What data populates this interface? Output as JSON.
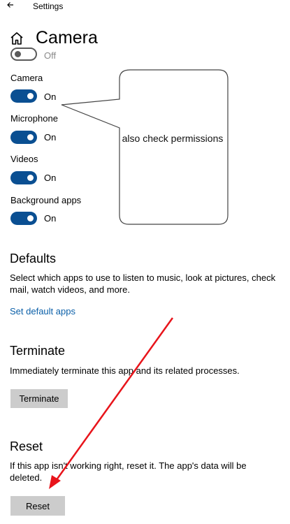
{
  "titlebar": {
    "title": "Settings"
  },
  "header": {
    "title": "Camera"
  },
  "toggles": [
    {
      "label": "",
      "state": "Off",
      "on": false
    },
    {
      "label": "Camera",
      "state": "On",
      "on": true
    },
    {
      "label": "Microphone",
      "state": "On",
      "on": true
    },
    {
      "label": "Videos",
      "state": "On",
      "on": true
    },
    {
      "label": "Background apps",
      "state": "On",
      "on": true
    }
  ],
  "callout": {
    "text": "also check permissions"
  },
  "defaults": {
    "heading": "Defaults",
    "description": "Select which apps to use to listen to music, look at pictures, check mail, watch videos, and more.",
    "link": "Set default apps"
  },
  "terminate": {
    "heading": "Terminate",
    "description": "Immediately terminate this app and its related processes.",
    "button": "Terminate"
  },
  "reset": {
    "heading": "Reset",
    "description": "If this app isn't working right, reset it. The app's data will be deleted.",
    "button": "Reset"
  },
  "colors": {
    "accent": "#0a4f92",
    "link": "#0a5fa8",
    "arrow": "#e8141b",
    "button": "#cccccc"
  },
  "icons": [
    "back-arrow-icon",
    "home-icon"
  ]
}
